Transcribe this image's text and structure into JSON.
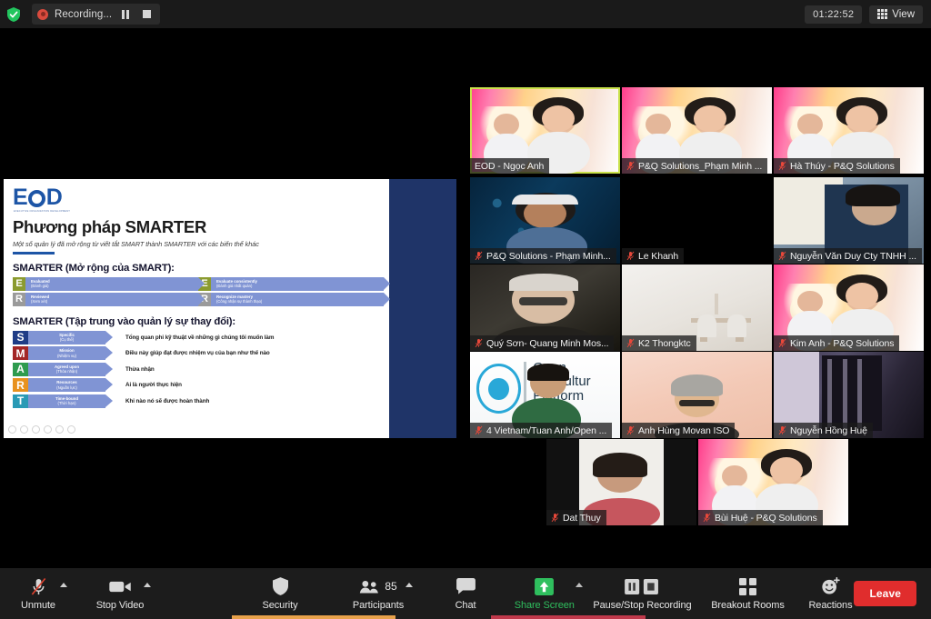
{
  "topbar": {
    "shield_icon": "security-shield-icon",
    "recording_dot_icon": "recording-dot-icon",
    "recording_label": "Recording...",
    "pause_icon": "pause-icon",
    "stop_icon": "stop-icon",
    "timer": "01:22:52",
    "view_label": "View",
    "view_icon": "grid-view-icon"
  },
  "slide": {
    "logo_text_left": "E",
    "logo_text_right": "D",
    "logo_sub": "EXECUTIVE ORGANIZATION DEVELOPMENT",
    "title": "Phương pháp SMARTER",
    "subtitle": "Một số quản lý đã mở rộng từ viết tắt SMART thành SMARTER với các biến thể khác",
    "section1": "SMARTER (Mở rộng của SMART):",
    "section2": "SMARTER (Tập trung vào quản lý sự thay đổi):",
    "er_left": [
      {
        "letter": "E",
        "color": "#8b9b2f",
        "t1": "Evaluated",
        "t2": "(Đánh giá)"
      },
      {
        "letter": "R",
        "color": "#9a9a9a",
        "t1": "Reviewed",
        "t2": "(Xem xét)"
      }
    ],
    "er_right": [
      {
        "letter": "E",
        "color": "#8b9b2f",
        "t1": "Evaluate consistently",
        "t2": "(Đánh giá nhất quán)"
      },
      {
        "letter": "R",
        "color": "#9a9a9a",
        "t1": "Recognize mastery",
        "t2": "(Công nhận sự thành thạo)"
      }
    ],
    "smarter_rows": [
      {
        "letter": "S",
        "color": "#1f3c86",
        "t1": "Specific",
        "t2": "(Cụ thể)",
        "desc": "Tổng quan phi kỹ thuật về những gì chúng tôi muốn làm"
      },
      {
        "letter": "M",
        "color": "#a32626",
        "t1": "Mission",
        "t2": "(Nhiệm vụ)",
        "desc": "Điều này giúp đạt được nhiệm vụ của bạn như thế nào"
      },
      {
        "letter": "A",
        "color": "#2e9b4e",
        "t1": "Agreed upon",
        "t2": "(Thỏa nhận)",
        "desc": "Thừa nhận"
      },
      {
        "letter": "R",
        "color": "#e8921f",
        "t1": "Resources",
        "t2": "(Nguồn lực)",
        "desc": "Ai là người thực hiện"
      },
      {
        "letter": "T",
        "color": "#2a9ab5",
        "t1": "Time-bound",
        "t2": "(Thời hạn)",
        "desc": "Khi nào nó sẽ được hoàn thành"
      }
    ],
    "navy_panel_color": "#1f3468"
  },
  "participants": [
    {
      "name": "EOD - Ngọc Anh",
      "muted": false,
      "active_speaker": true,
      "bg": "bg-pq"
    },
    {
      "name": "P&Q Solutions_Phạm Minh ...",
      "muted": true,
      "active_speaker": false,
      "bg": "bg-pq"
    },
    {
      "name": "Hà Thúy - P&Q Solutions",
      "muted": true,
      "active_speaker": false,
      "bg": "bg-pq"
    },
    {
      "name": "P&Q Solutions - Phạm Minh...",
      "muted": true,
      "active_speaker": false,
      "bg": "bg-tech"
    },
    {
      "name": "Le Khanh",
      "muted": true,
      "active_speaker": false,
      "bg": "bg-black"
    },
    {
      "name": "Nguyễn Văn Duy Cty TNHH ...",
      "muted": true,
      "active_speaker": false,
      "bg": "bg-room"
    },
    {
      "name": "Quý Sơn- Quang Minh Mos...",
      "muted": true,
      "active_speaker": false,
      "bg": "bg-dark-room"
    },
    {
      "name": "K2 Thongktc",
      "muted": true,
      "active_speaker": false,
      "bg": "bg-wall"
    },
    {
      "name": "Kim Anh - P&Q Solutions",
      "muted": true,
      "active_speaker": false,
      "bg": "bg-pq"
    },
    {
      "name": "4 Vietnam/Tuan Anh/Open ...",
      "muted": true,
      "active_speaker": false,
      "bg": "bg-openag"
    },
    {
      "name": "Anh Hùng Movan ISO",
      "muted": true,
      "active_speaker": false,
      "bg": "bg-peach"
    },
    {
      "name": "Nguyễn Hồng Huệ",
      "muted": true,
      "active_speaker": false,
      "bg": "bg-window"
    },
    {
      "name": "Dat Thuy",
      "muted": true,
      "active_speaker": false,
      "bg": "bg-white"
    },
    {
      "name": "Bùi Huệ - P&Q Solutions",
      "muted": true,
      "active_speaker": false,
      "bg": "bg-pq"
    }
  ],
  "toolbar": {
    "unmute": {
      "label": "Unmute",
      "icon": "microphone-muted-icon",
      "has_caret": true
    },
    "stop_video": {
      "label": "Stop Video",
      "icon": "video-camera-icon",
      "has_caret": true
    },
    "security": {
      "label": "Security",
      "icon": "shield-icon",
      "has_caret": false
    },
    "participants": {
      "label": "Participants",
      "icon": "people-icon",
      "count": "85",
      "has_caret": true
    },
    "chat": {
      "label": "Chat",
      "icon": "chat-bubble-icon",
      "has_caret": false
    },
    "share_screen": {
      "label": "Share Screen",
      "icon": "share-screen-up-arrow-icon",
      "has_caret": true,
      "color": "#2fbf5e"
    },
    "recording": {
      "label": "Pause/Stop Recording",
      "icon": "pause-stop-icon",
      "has_caret": false
    },
    "breakout": {
      "label": "Breakout Rooms",
      "icon": "breakout-grid-icon",
      "has_caret": false
    },
    "reactions": {
      "label": "Reactions",
      "icon": "smiley-plus-icon",
      "has_caret": false
    },
    "leave": {
      "label": "Leave",
      "color": "#e02d2d"
    }
  }
}
